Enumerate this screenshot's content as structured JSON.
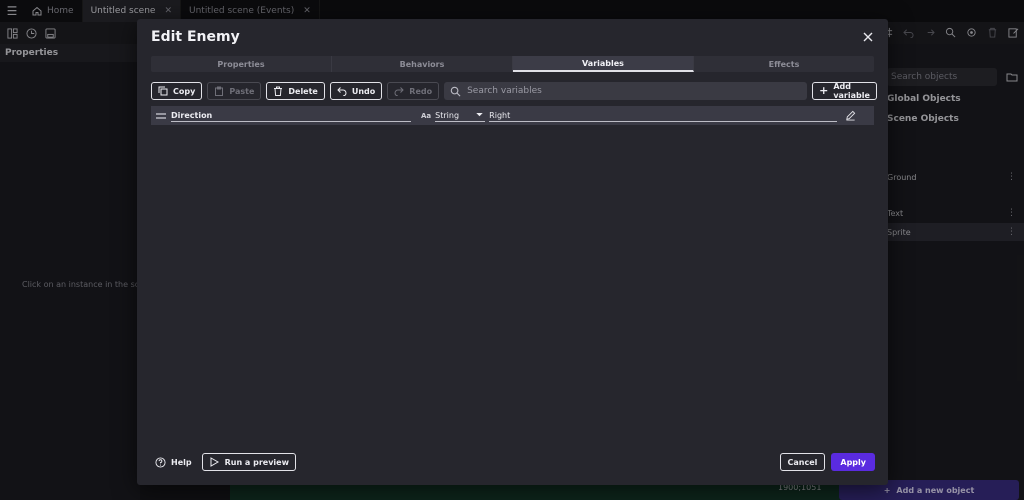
{
  "topbar": {
    "tabs": [
      {
        "label": "Home",
        "icon": "home-icon"
      },
      {
        "label": "Untitled scene",
        "active": true,
        "closable": true
      },
      {
        "label": "Untitled scene (Events)",
        "closable": true
      }
    ],
    "close_glyph": "✕"
  },
  "properties_panel": {
    "title": "Properties",
    "hint": "Click on an instance in the scene"
  },
  "scene": {
    "coordinates": "1900;1051"
  },
  "objects_panel": {
    "search_placeholder": "Search objects",
    "headings": [
      "Global Objects",
      "Scene Objects"
    ],
    "rows": [
      "Ground",
      "Text",
      "Sprite"
    ],
    "add_button_label": "Add a new object"
  },
  "dialog": {
    "title": "Edit Enemy",
    "tabs": [
      "Properties",
      "Behaviors",
      "Variables",
      "Effects"
    ],
    "active_tab": "Variables",
    "toolbar": {
      "copy": "Copy",
      "paste": "Paste",
      "delete": "Delete",
      "undo": "Undo",
      "redo": "Redo",
      "search_placeholder": "Search variables",
      "add_variable": "Add variable"
    },
    "variables": [
      {
        "name": "Direction",
        "type_glyph": "Aa",
        "type": "String",
        "value": "Right"
      }
    ],
    "footer": {
      "help": "Help",
      "run_preview": "Run a preview",
      "cancel": "Cancel",
      "apply": "Apply"
    }
  },
  "colors": {
    "accent": "#5a2be0",
    "dialog_bg": "#26262d"
  }
}
